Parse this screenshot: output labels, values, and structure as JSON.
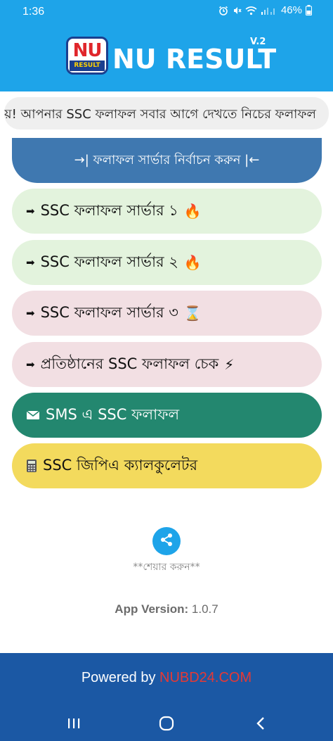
{
  "status_bar": {
    "time": "1:36",
    "battery": "46%"
  },
  "header": {
    "logo_top": "NU",
    "logo_bottom": "RESULT",
    "title": "NU RESULT",
    "version_tag": "V.2",
    "background_color": "#1ea4e9"
  },
  "marquee": {
    "text": "য়! আপনার SSC ফলাফল সবার আগে দেখতে নিচের ফলাফল"
  },
  "server_header": {
    "label": "→| ফলাফল সার্ভার নির্বাচন করুন |←"
  },
  "menu": [
    {
      "arrow": "➡",
      "label": "SSC ফলাফল সার্ভার ১",
      "emoji": "🔥",
      "color": "#e3f3dd"
    },
    {
      "arrow": "➡",
      "label": "SSC ফলাফল সার্ভার ২",
      "emoji": "🔥",
      "color": "#e3f3dd"
    },
    {
      "arrow": "➡",
      "label": "SSC ফলাফল সার্ভার ৩",
      "emoji": "⌛",
      "color": "#f2dfe3"
    },
    {
      "arrow": "➡",
      "label": "প্রতিষ্ঠানের SSC ফলাফল চেক",
      "emoji": "⚡",
      "color": "#f2dfe3"
    },
    {
      "icon": "envelope-icon",
      "label": "SMS এ SSC ফলাফল",
      "color": "#23876f"
    },
    {
      "icon": "calculator-icon",
      "label": "SSC জিপিএ ক্যালকুলেটর",
      "color": "#f3da5d"
    }
  ],
  "share": {
    "icon": "share-icon",
    "label": "**শেয়ার করুন**"
  },
  "app_version": {
    "label": "App Version:",
    "value": "1.0.7"
  },
  "footer": {
    "powered_by": "Powered by",
    "link": "NUBD24.COM",
    "link_color": "#e53935"
  },
  "nav": {
    "recent": "recent-apps-icon",
    "home": "home-icon",
    "back": "back-icon"
  }
}
